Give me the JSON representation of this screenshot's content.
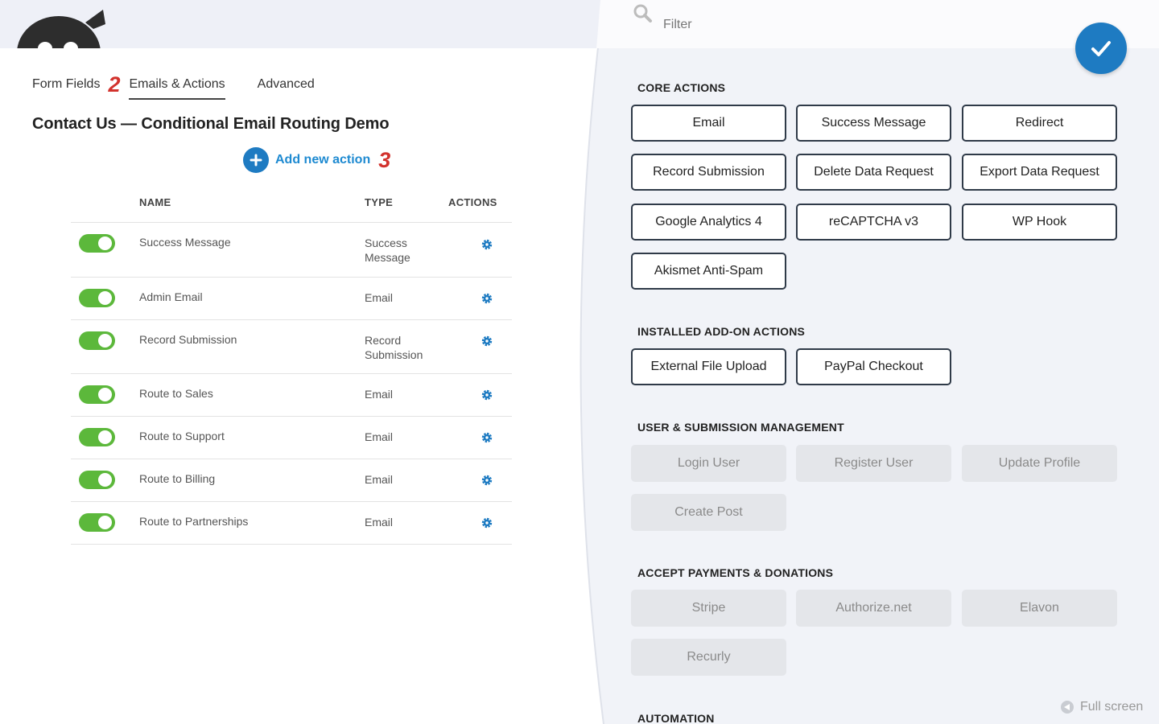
{
  "builder": {
    "tabs": [
      {
        "label": "Form Fields",
        "step": "2"
      },
      {
        "label": "Emails & Actions"
      },
      {
        "label": "Advanced"
      }
    ],
    "form_title": "Contact Us — Conditional Email Routing Demo",
    "add_action": {
      "label": "Add new action",
      "step": "3"
    },
    "table": {
      "headers": {
        "name": "NAME",
        "type": "TYPE",
        "actions": "ACTIONS"
      },
      "rows": [
        {
          "name": "Success Message",
          "type": "Success Message",
          "enabled": true
        },
        {
          "name": "Admin Email",
          "type": "Email",
          "enabled": true
        },
        {
          "name": "Record Submission",
          "type": "Record Submission",
          "enabled": true
        },
        {
          "name": "Route to Sales",
          "type": "Email",
          "enabled": true
        },
        {
          "name": "Route to Support",
          "type": "Email",
          "enabled": true
        },
        {
          "name": "Route to Billing",
          "type": "Email",
          "enabled": true
        },
        {
          "name": "Route to Partnerships",
          "type": "Email",
          "enabled": true
        }
      ]
    }
  },
  "drawer": {
    "filter_placeholder": "Filter",
    "sections": [
      {
        "title": "CORE ACTIONS",
        "style": "active",
        "buttons": [
          "Email",
          "Success Message",
          "Redirect",
          "Record Submission",
          "Delete Data Request",
          "Export Data Request",
          "Google Analytics 4",
          "reCAPTCHA v3",
          "WP Hook",
          "Akismet Anti-Spam"
        ]
      },
      {
        "title": "INSTALLED ADD-ON ACTIONS",
        "style": "active",
        "buttons": [
          "External File Upload",
          "PayPal Checkout"
        ]
      },
      {
        "title": "USER & SUBMISSION MANAGEMENT",
        "style": "disabled",
        "buttons": [
          "Login User",
          "Register User",
          "Update Profile",
          "Create Post"
        ]
      },
      {
        "title": "ACCEPT PAYMENTS & DONATIONS",
        "style": "disabled",
        "buttons": [
          "Stripe",
          "Authorize.net",
          "Elavon",
          "Recurly"
        ]
      },
      {
        "title": "AUTOMATION",
        "style": "disabled",
        "buttons": []
      }
    ],
    "fullscreen_label": "Full screen"
  },
  "colors": {
    "accent": "#1e7bc2",
    "toggle_on": "#5cb83b",
    "step_number": "#d2322d",
    "header_bg": "#eef0f7",
    "drawer_bg": "#f1f3f8"
  }
}
